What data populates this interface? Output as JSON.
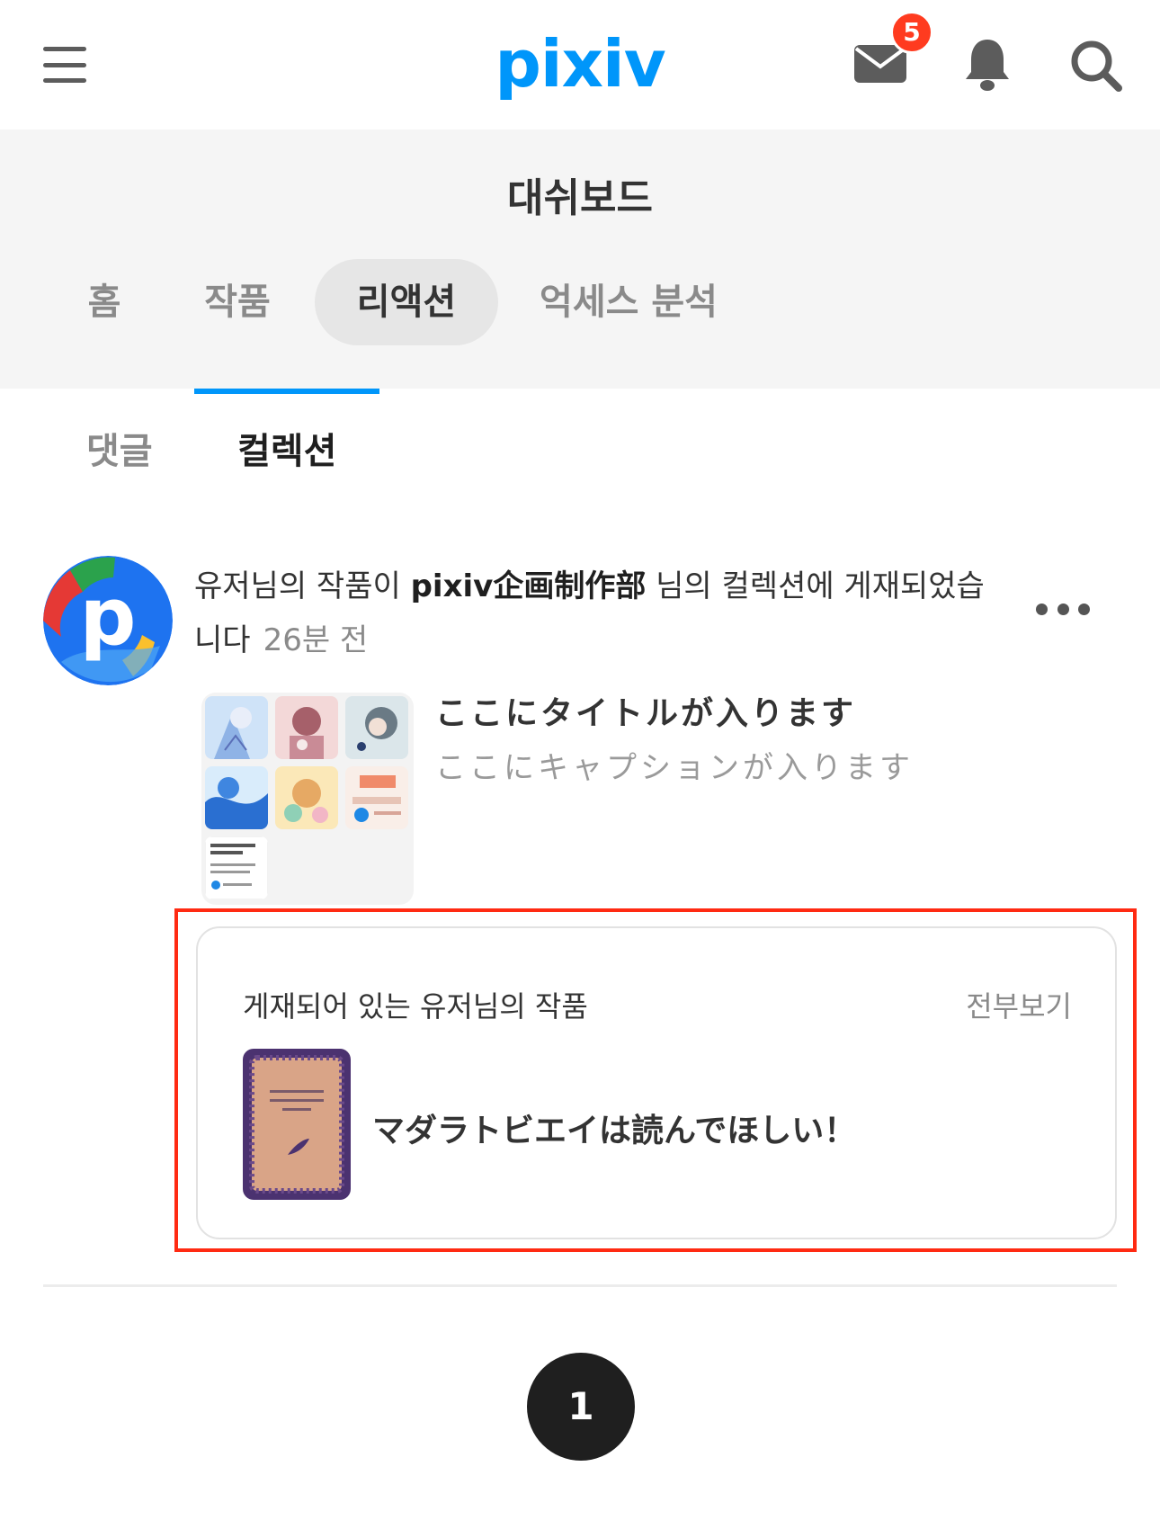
{
  "header": {
    "logo": "pixiv",
    "mail_badge": "5",
    "icons": [
      "hamburger-icon",
      "mail-icon",
      "bell-icon",
      "search-icon"
    ]
  },
  "dashboard": {
    "title": "대쉬보드",
    "tabs": [
      {
        "label": "홈",
        "active": false
      },
      {
        "label": "작품",
        "active": false
      },
      {
        "label": "리액션",
        "active": true
      },
      {
        "label": "억세스 분석",
        "active": false
      }
    ]
  },
  "subtabs": [
    {
      "label": "댓글",
      "active": false
    },
    {
      "label": "컬렉션",
      "active": true
    }
  ],
  "notification": {
    "prefix": "유저님의 작품이 ",
    "user": "pixiv企画制作部",
    "suffix": " 님의 컬렉션에 게재되었습니다",
    "time": "26분 전",
    "collection": {
      "title": "ここにタイトルが入ります",
      "caption": "ここにキャプションが入ります"
    },
    "posted_works": {
      "label": "게재되어 있는 유저님의 작품",
      "see_all": "전부보기",
      "work_title": "マダラトビエイは読んでほしい！"
    }
  },
  "pagination": {
    "current": "1"
  },
  "colors": {
    "accent": "#0096fa",
    "badge": "#ff3b1f",
    "highlight": "#ff2a12"
  }
}
